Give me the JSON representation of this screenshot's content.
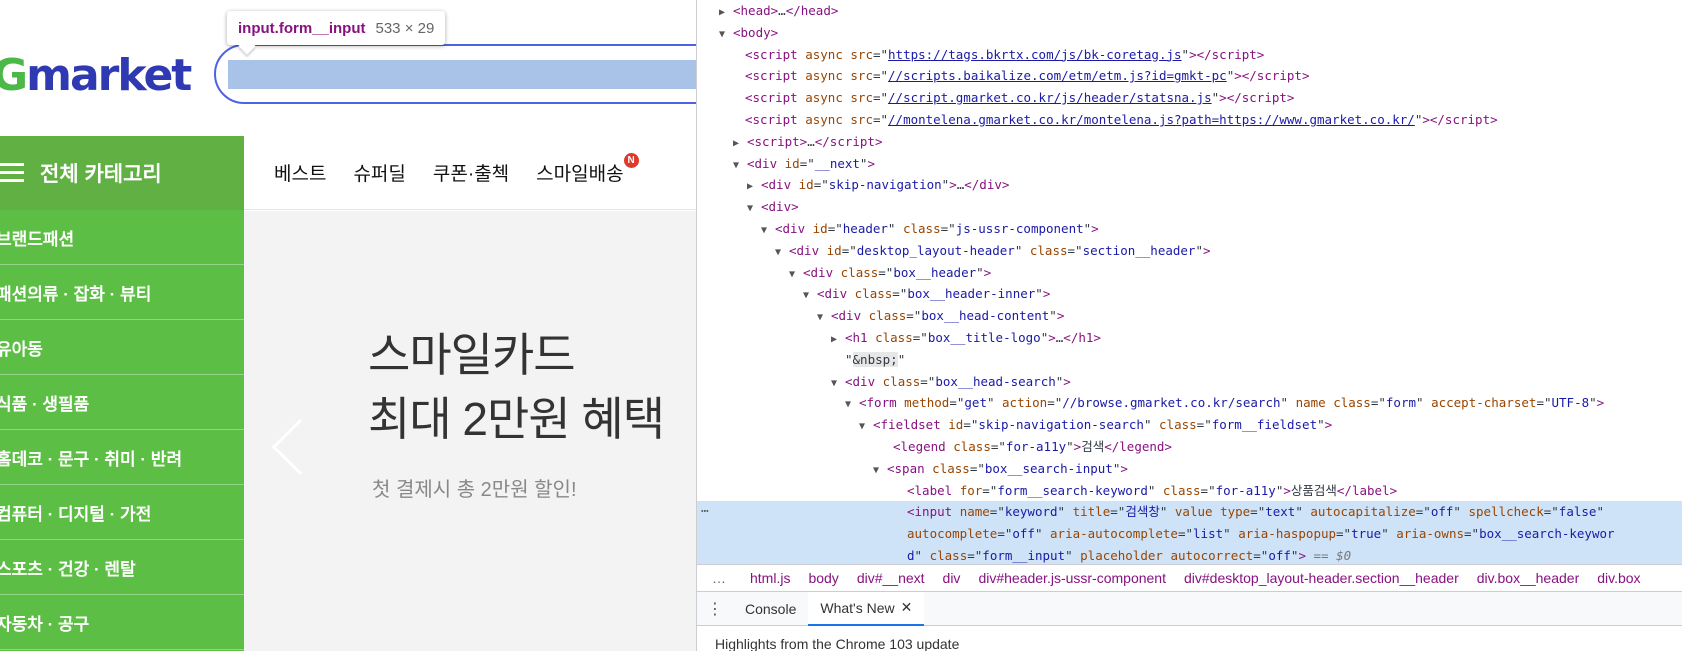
{
  "page": {
    "logo_g": "G",
    "logo_rest": "market",
    "tooltip": {
      "selector": "input.form__input",
      "size": "533 × 29"
    },
    "category": {
      "title": "전체 카테고리",
      "items": [
        "브랜드패션",
        "패션의류 · 잡화 · 뷰티",
        "유아동",
        "식품 · 생필품",
        "홈데코 · 문구 · 취미 · 반려",
        "컴퓨터 · 디지털 · 가전",
        "스포츠 · 건강 · 렌탈",
        "자동차 · 공구"
      ]
    },
    "gnb": [
      "베스트",
      "슈퍼딜",
      "쿠폰·출첵",
      "스마일배송"
    ],
    "gnb_badge": "N",
    "banner": {
      "line1": "스마일카드",
      "line2": "최대 2만원 혜택",
      "sub": "첫 결제시 총 2만원 할인!"
    }
  },
  "devtools": {
    "breadcrumbs": [
      "html.js",
      "body",
      "div#__next",
      "div",
      "div#header.js-ussr-component",
      "div#desktop_layout-header.section__header",
      "div.box__header",
      "div.box"
    ],
    "drawer_tabs": [
      "Console",
      "What's New"
    ],
    "highlights": "Highlights from the Chrome 103 update",
    "dom_text": {
      "legend": "검색",
      "label": "상품검색",
      "title_value": "검색창",
      "nbsp": "&nbsp;",
      "eq": "== $0"
    }
  },
  "colors": {
    "gmarket_blue": "#2f3ab2",
    "gmarket_green": "#4cb848",
    "category_green": "#5dbe45",
    "devtools_tag": "#881280",
    "devtools_attr": "#994500",
    "devtools_value": "#1a1aa6"
  }
}
